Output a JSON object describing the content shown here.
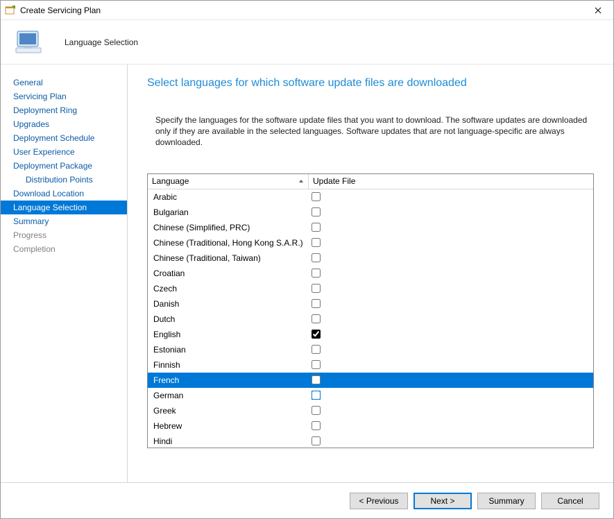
{
  "title": "Create Servicing Plan",
  "header": {
    "step_title": "Language Selection"
  },
  "sidebar": {
    "items": [
      {
        "label": "General",
        "state": "link"
      },
      {
        "label": "Servicing Plan",
        "state": "link"
      },
      {
        "label": "Deployment Ring",
        "state": "link"
      },
      {
        "label": "Upgrades",
        "state": "link"
      },
      {
        "label": "Deployment Schedule",
        "state": "link"
      },
      {
        "label": "User Experience",
        "state": "link"
      },
      {
        "label": "Deployment Package",
        "state": "link"
      },
      {
        "label": "Distribution Points",
        "state": "link",
        "sub": true
      },
      {
        "label": "Download Location",
        "state": "link"
      },
      {
        "label": "Language Selection",
        "state": "selected"
      },
      {
        "label": "Summary",
        "state": "link"
      },
      {
        "label": "Progress",
        "state": "disabled"
      },
      {
        "label": "Completion",
        "state": "disabled"
      }
    ]
  },
  "main": {
    "heading": "Select languages for which software update files are downloaded",
    "instruction": "Specify the languages for the software update files that you want to download. The software updates are downloaded only if they are available in the selected languages. Software updates that are not language-specific are always downloaded.",
    "columns": {
      "language": "Language",
      "update_file": "Update File"
    },
    "rows": [
      {
        "language": "Arabic",
        "checked": false,
        "selected": false
      },
      {
        "language": "Bulgarian",
        "checked": false,
        "selected": false
      },
      {
        "language": "Chinese (Simplified, PRC)",
        "checked": false,
        "selected": false
      },
      {
        "language": "Chinese (Traditional, Hong Kong S.A.R.)",
        "checked": false,
        "selected": false
      },
      {
        "language": "Chinese (Traditional, Taiwan)",
        "checked": false,
        "selected": false
      },
      {
        "language": "Croatian",
        "checked": false,
        "selected": false
      },
      {
        "language": "Czech",
        "checked": false,
        "selected": false
      },
      {
        "language": "Danish",
        "checked": false,
        "selected": false
      },
      {
        "language": "Dutch",
        "checked": false,
        "selected": false
      },
      {
        "language": "English",
        "checked": true,
        "selected": false
      },
      {
        "language": "Estonian",
        "checked": false,
        "selected": false
      },
      {
        "language": "Finnish",
        "checked": false,
        "selected": false
      },
      {
        "language": "French",
        "checked": false,
        "selected": true
      },
      {
        "language": "German",
        "checked": false,
        "selected": false,
        "focusring": true
      },
      {
        "language": "Greek",
        "checked": false,
        "selected": false
      },
      {
        "language": "Hebrew",
        "checked": false,
        "selected": false
      },
      {
        "language": "Hindi",
        "checked": false,
        "selected": false
      }
    ]
  },
  "footer": {
    "previous": "< Previous",
    "next": "Next >",
    "summary": "Summary",
    "cancel": "Cancel"
  }
}
